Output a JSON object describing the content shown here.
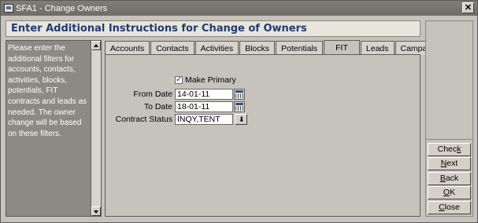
{
  "window": {
    "title": "SFA1 - Change Owners"
  },
  "header": {
    "heading": "Enter Additional Instructions for Change of Owners"
  },
  "instructions": {
    "text": "Please enter the additional filters for accounts, contacts, activities, blocks, potentials, FIT contracts and leads as needed. The owner change will be based on these filters."
  },
  "tabs": [
    {
      "label": "Accounts",
      "active": false
    },
    {
      "label": "Contacts",
      "active": false
    },
    {
      "label": "Activities",
      "active": false
    },
    {
      "label": "Blocks",
      "active": false
    },
    {
      "label": "Potentials",
      "active": false
    },
    {
      "label": "FIT",
      "active": true
    },
    {
      "label": "Leads",
      "active": false
    },
    {
      "label": "Campaings",
      "active": false
    }
  ],
  "form": {
    "make_primary": {
      "label": "Make Primary",
      "checked": true
    },
    "from_date": {
      "label": "From Date",
      "value": "14-01-11"
    },
    "to_date": {
      "label": "To Date",
      "value": "18-01-11"
    },
    "contract_status": {
      "label": "Contract Status",
      "value": "INQY,TENT"
    }
  },
  "buttons": {
    "check": {
      "label": "Check",
      "accel": "k"
    },
    "next": {
      "label": "Next",
      "accel": "N"
    },
    "back": {
      "label": "Back",
      "accel": "B"
    },
    "ok": {
      "label": "OK",
      "accel": "O"
    },
    "close": {
      "label": "Close",
      "accel": "C"
    }
  }
}
